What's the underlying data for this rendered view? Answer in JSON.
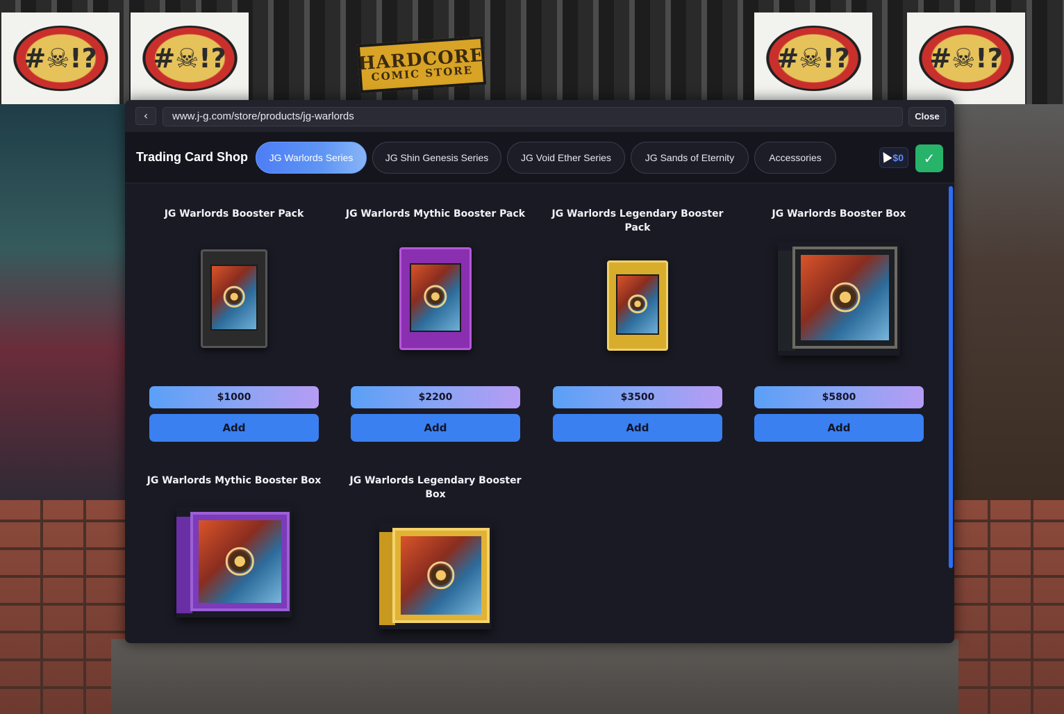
{
  "browser": {
    "back_icon": "‹",
    "url": "www.j-g.com/store/products/jg-warlords",
    "close_label": "Close"
  },
  "shop": {
    "title": "Trading Card Shop",
    "balance": "$0",
    "confirm_icon": "✓",
    "tabs": [
      {
        "label": "JG Warlords Series",
        "active": true
      },
      {
        "label": "JG Shin Genesis Series",
        "active": false
      },
      {
        "label": "JG Void Ether Series",
        "active": false
      },
      {
        "label": "JG Sands of Eternity",
        "active": false
      },
      {
        "label": "Accessories",
        "active": false
      }
    ]
  },
  "products": [
    {
      "name": "JG Warlords Booster Pack",
      "price": "$1000",
      "add_label": "Add",
      "image": "black-booster-pack"
    },
    {
      "name": "JG Warlords Mythic Booster Pack",
      "price": "$2200",
      "add_label": "Add",
      "image": "purple-booster-pack"
    },
    {
      "name": "JG Warlords Legendary Booster Pack",
      "price": "$3500",
      "add_label": "Add",
      "image": "gold-booster-pack"
    },
    {
      "name": "JG Warlords Booster Box",
      "price": "$5800",
      "add_label": "Add",
      "image": "black-booster-box"
    },
    {
      "name": "JG Warlords Mythic Booster Box",
      "image": "purple-booster-box"
    },
    {
      "name": "JG Warlords Legendary Booster Box",
      "image": "gold-booster-box"
    }
  ],
  "background": {
    "store_sign_line1": "HARDCORE",
    "store_sign_line2": "COMIC STORE",
    "poster_text": "#☠!?"
  },
  "colors": {
    "accent": "#3a80f0",
    "confirm": "#27b36a",
    "balance_text": "#5a8bff"
  }
}
